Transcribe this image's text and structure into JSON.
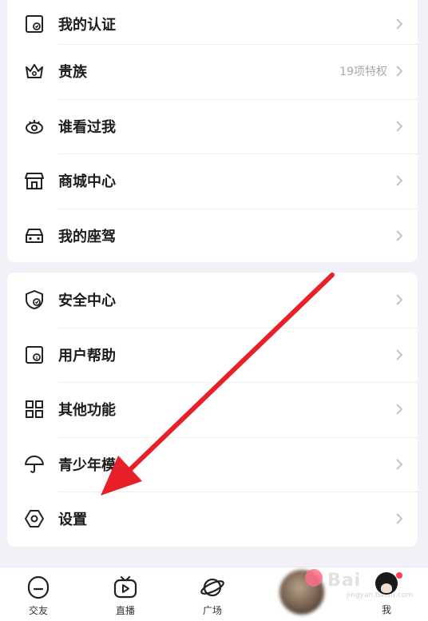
{
  "menu_group_1": [
    {
      "label": "我的认证",
      "icon": "certification-icon"
    },
    {
      "label": "贵族",
      "icon": "crown-icon",
      "extra": "19项特权"
    },
    {
      "label": "谁看过我",
      "icon": "eye-icon"
    },
    {
      "label": "商城中心",
      "icon": "store-icon"
    },
    {
      "label": "我的座驾",
      "icon": "car-icon"
    }
  ],
  "menu_group_2": [
    {
      "label": "安全中心",
      "icon": "shield-icon"
    },
    {
      "label": "用户帮助",
      "icon": "help-document-icon"
    },
    {
      "label": "其他功能",
      "icon": "grid-icon"
    },
    {
      "label": "青少年模",
      "icon": "umbrella-icon"
    },
    {
      "label": "设置",
      "icon": "settings-hexagon-icon"
    }
  ],
  "tabbar": {
    "items": [
      {
        "label": "交友",
        "icon": "friends-tab-icon"
      },
      {
        "label": "直播",
        "icon": "live-tv-icon"
      },
      {
        "label": "广场",
        "icon": "planet-icon"
      },
      {
        "label": "我",
        "icon": "profile-avatar"
      }
    ]
  },
  "watermark": {
    "text": "Bai",
    "sub": "jingyan.baidu.com"
  },
  "colors": {
    "annotation_arrow": "#e8202a",
    "background": "#f1f1f7",
    "badge": "#ff3d5a"
  }
}
